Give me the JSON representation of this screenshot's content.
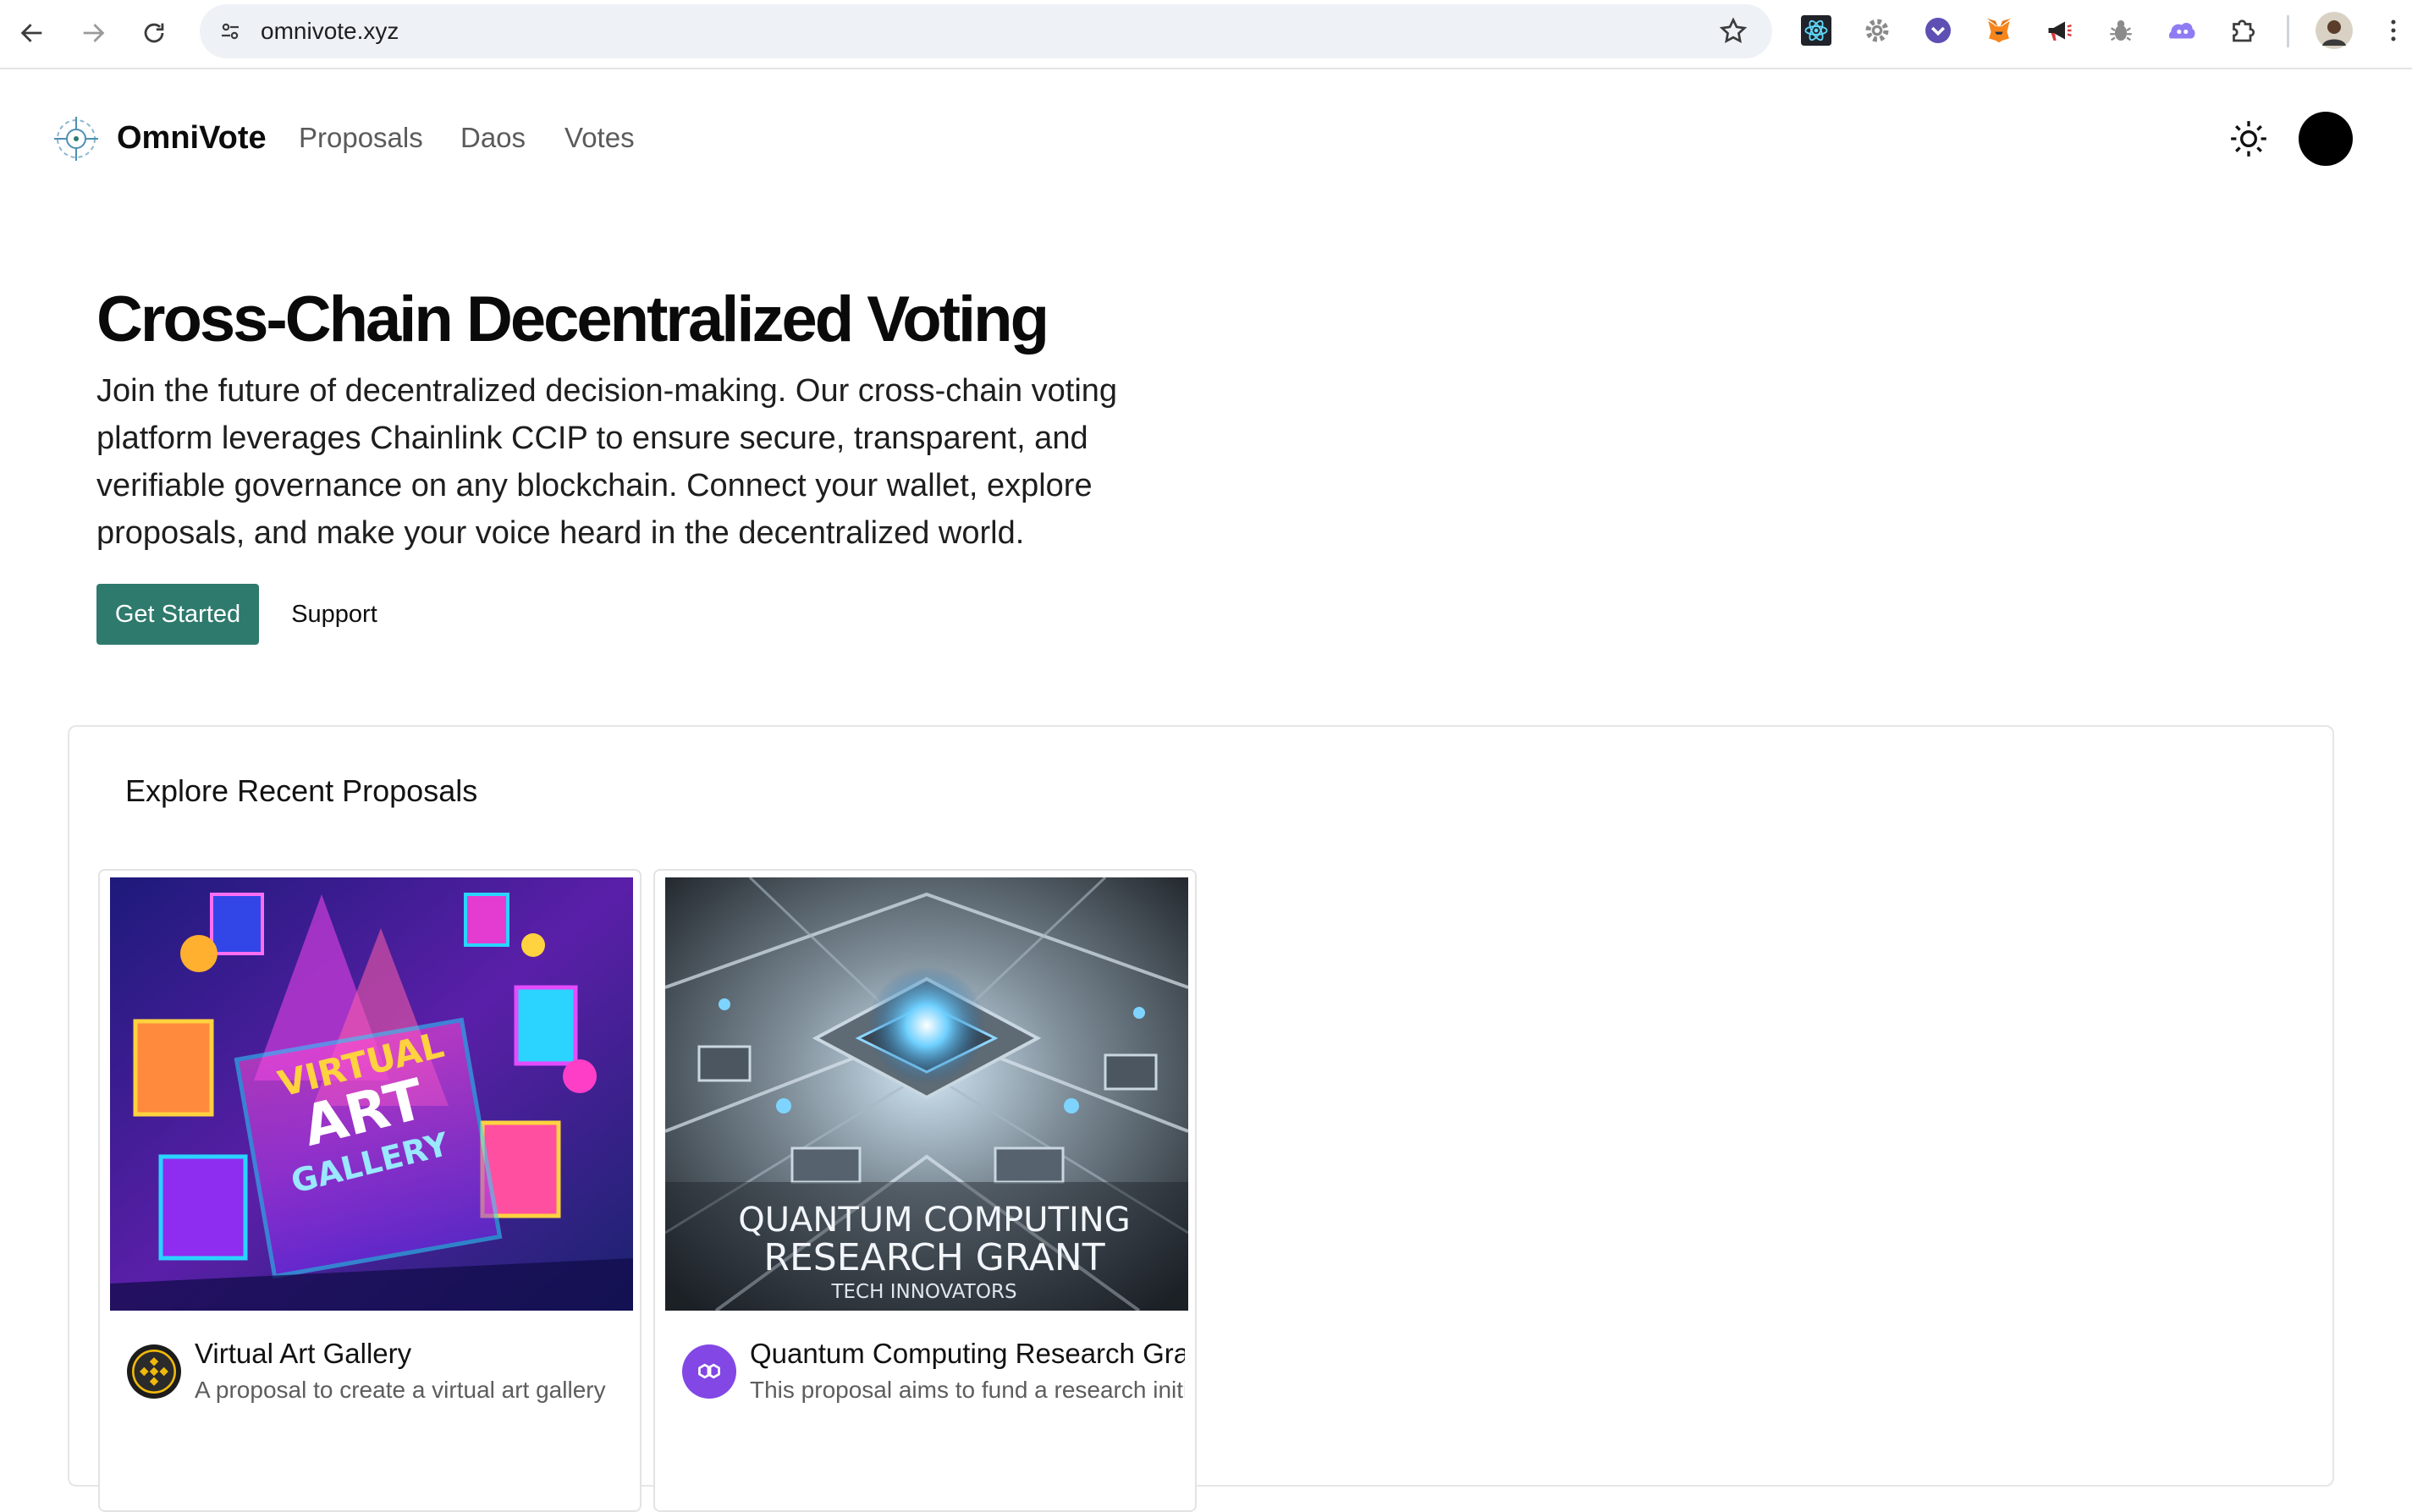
{
  "browser": {
    "url": "omnivote.xyz",
    "extensions": [
      "react-devtools-icon",
      "settings-gear-icon",
      "chevron-circle-icon",
      "metamask-fox-icon",
      "megaphone-icon",
      "bug-icon",
      "purple-cloud-icon",
      "puzzle-piece-icon"
    ]
  },
  "header": {
    "brand": "OmniVote",
    "nav": [
      "Proposals",
      "Daos",
      "Votes"
    ]
  },
  "hero": {
    "title": "Cross-Chain Decentralized Voting",
    "description": "Join the future of decentralized decision-making. Our cross-chain voting platform leverages Chainlink CCIP to ensure secure, transparent, and verifiable governance on any blockchain. Connect your wallet, explore proposals, and make your voice heard in the decentralized world.",
    "primary_cta": "Get Started",
    "secondary_cta": "Support"
  },
  "proposals": {
    "heading": "Explore Recent Proposals",
    "cards": [
      {
        "title": "Virtual Art Gallery",
        "description": "A proposal to create a virtual art gallery",
        "image_text": [
          "VIRTUAL",
          "ART",
          "GALLERY"
        ],
        "chain_icon": "bnb-icon"
      },
      {
        "title": "Quantum Computing Research Grant",
        "description": "This proposal aims to fund a research initiative",
        "image_text": [
          "QUANTUM COMPUTING",
          "RESEARCH GRANT",
          "TECH INNOVATORS"
        ],
        "chain_icon": "polygon-icon"
      }
    ]
  },
  "colors": {
    "accent": "#2e7a6d",
    "polygon": "#8247e5",
    "bnb": "#f0b90b"
  }
}
